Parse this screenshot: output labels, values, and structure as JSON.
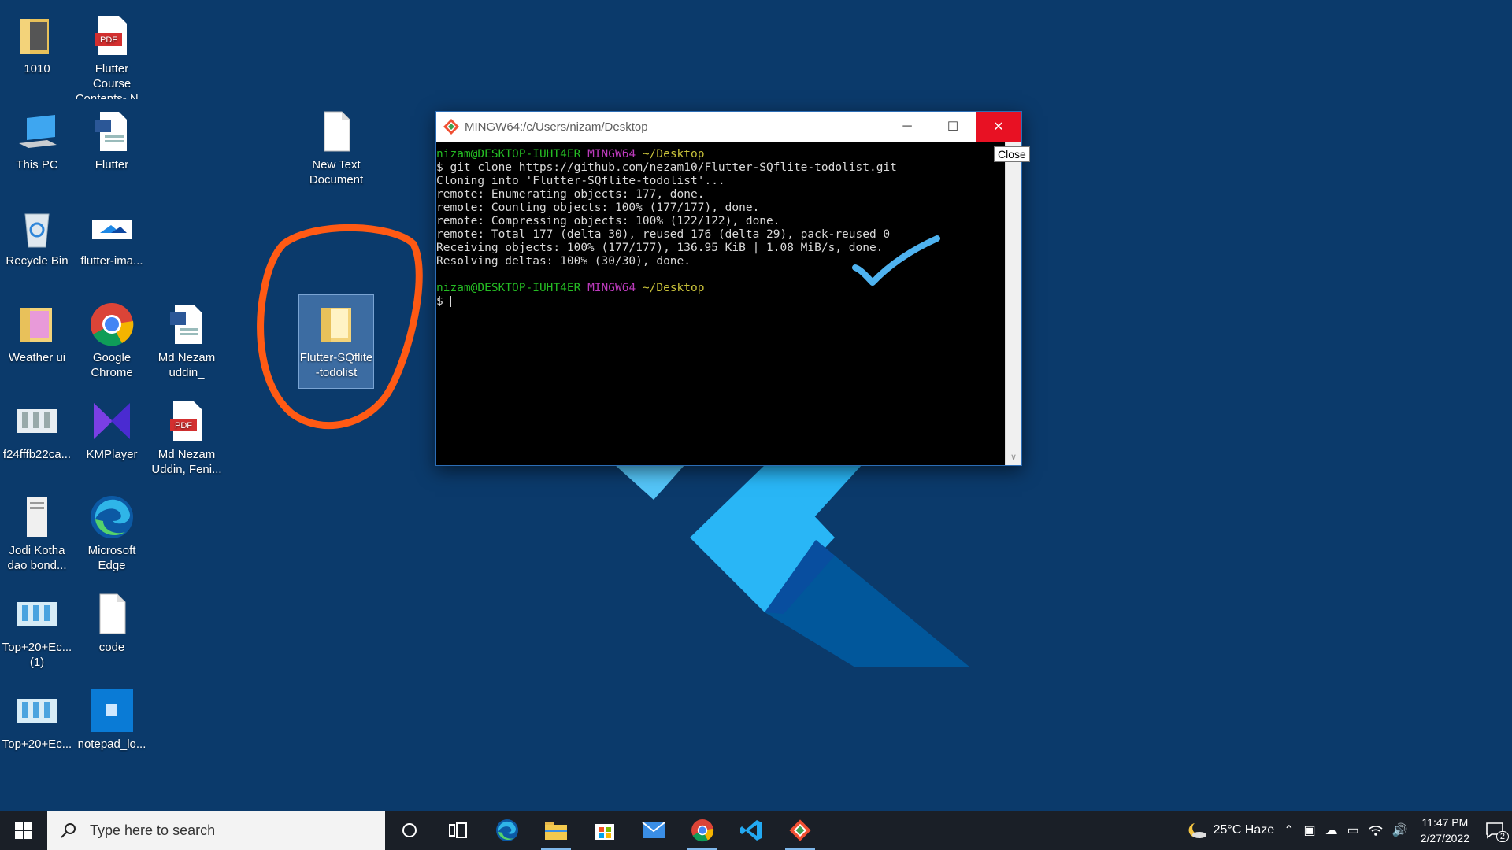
{
  "desktop": {
    "icons": [
      {
        "label": "1010"
      },
      {
        "label": "Flutter Course Contents- N..."
      },
      {
        "label": "This PC"
      },
      {
        "label": "Flutter"
      },
      {
        "label": "New Text Document"
      },
      {
        "label": "Recycle Bin"
      },
      {
        "label": "flutter-ima..."
      },
      {
        "label": "Weather ui"
      },
      {
        "label": "Google Chrome"
      },
      {
        "label": "Md Nezam uddin_"
      },
      {
        "label": "Flutter-SQflite-todolist"
      },
      {
        "label": "f24fffb22ca..."
      },
      {
        "label": "KMPlayer"
      },
      {
        "label": "Md Nezam Uddin, Feni..."
      },
      {
        "label": "Jodi Kotha dao bond..."
      },
      {
        "label": "Microsoft Edge"
      },
      {
        "label": "Top+20+Ec... (1)"
      },
      {
        "label": "code"
      },
      {
        "label": "Top+20+Ec..."
      },
      {
        "label": "notepad_lo..."
      }
    ],
    "pdf_badge": "PDF"
  },
  "terminal": {
    "title": "MINGW64:/c/Users/nizam/Desktop",
    "tooltip": "Close",
    "prompt_user": "nizam@DESKTOP-IUHT4ER",
    "prompt_env": "MINGW64",
    "prompt_dir": "~/Desktop",
    "lines": [
      "$ git clone https://github.com/nezam10/Flutter-SQflite-todolist.git",
      "Cloning into 'Flutter-SQflite-todolist'...",
      "remote: Enumerating objects: 177, done.",
      "remote: Counting objects: 100% (177/177), done.",
      "remote: Compressing objects: 100% (122/122), done.",
      "remote: Total 177 (delta 30), reused 176 (delta 29), pack-reused 0",
      "Receiving objects: 100% (177/177), 136.95 KiB | 1.08 MiB/s, done.",
      "Resolving deltas: 100% (30/30), done."
    ],
    "prompt_symbol": "$ "
  },
  "taskbar": {
    "search_placeholder": "Type here to search",
    "weather": "25°C  Haze",
    "time": "11:47 PM",
    "date": "2/27/2022",
    "notification_count": "2"
  },
  "colors": {
    "desktop_bg": "#0b3a6b",
    "annotation_orange": "#ff5a14",
    "annotation_blue": "#4fb3f0",
    "close_red": "#e81123"
  }
}
